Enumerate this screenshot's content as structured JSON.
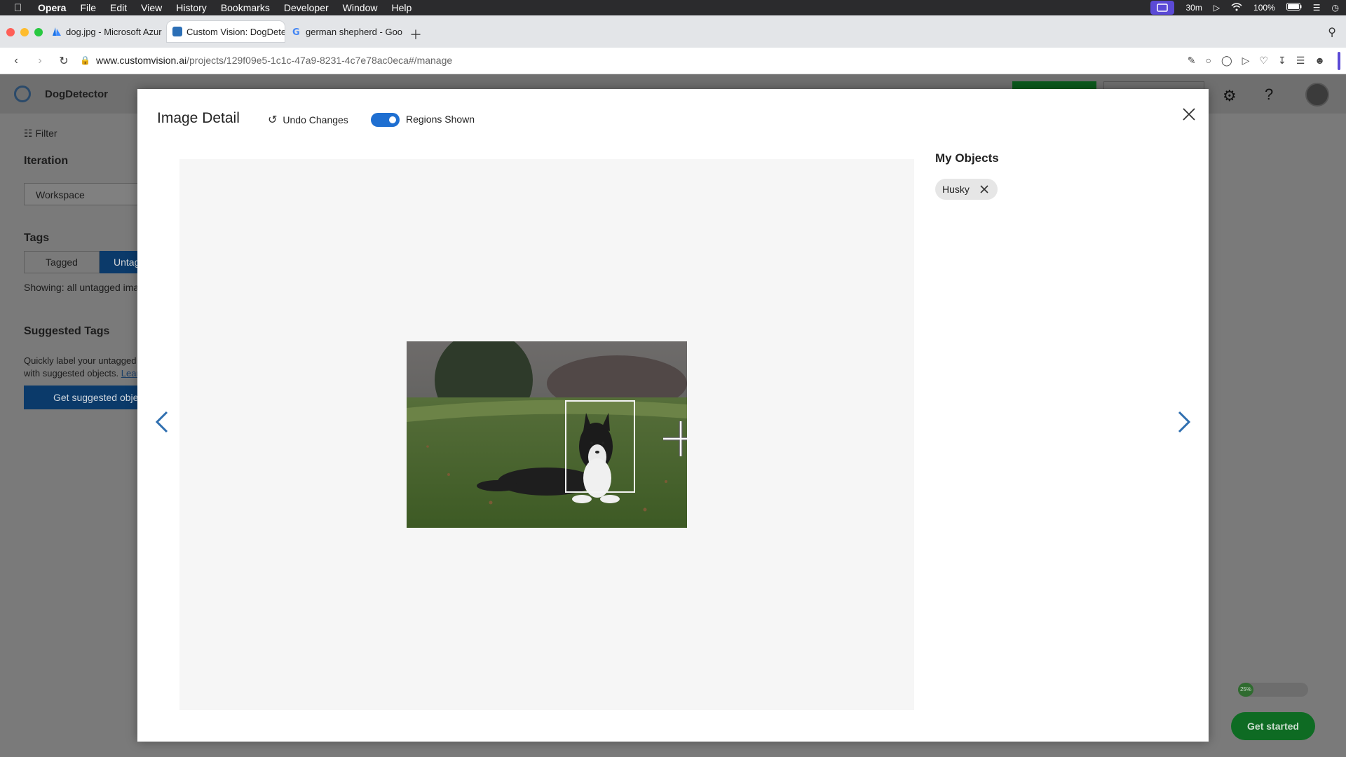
{
  "menubar": {
    "app": "Opera",
    "items": [
      "File",
      "Edit",
      "View",
      "History",
      "Bookmarks",
      "Developer",
      "Window",
      "Help"
    ],
    "timer": "30m",
    "battery": "100%"
  },
  "tabs": [
    {
      "label": "dog.jpg - Microsoft Azur",
      "favicon_color": "#1a73e8"
    },
    {
      "label": "Custom Vision: DogDete",
      "favicon_color": "#2c6fb6"
    },
    {
      "label": "german shepherd - Goo",
      "favicon_color": "#ea4335"
    }
  ],
  "address": {
    "domain": "www.customvision.ai",
    "path": "/projects/129f09e5-1c1c-47a9-8231-4c7e78ac0eca#/manage"
  },
  "background": {
    "project_name": "DogDetector",
    "filter_label": "Filter",
    "iteration_heading": "Iteration",
    "workspace_label": "Workspace",
    "tags_heading": "Tags",
    "tagged_label": "Tagged",
    "untagged_label": "Untag",
    "showing_text": "Showing: all untagged ima",
    "suggested_heading": "Suggested Tags",
    "quick_text": "Quickly label your untagged with suggested objects.",
    "quick_link": "Lear",
    "get_suggested_label": "Get suggested objec",
    "progress_label": "25%",
    "get_started_label": "Get started"
  },
  "modal": {
    "title": "Image Detail",
    "undo_label": "Undo Changes",
    "regions_label": "Regions Shown",
    "regions_on": true,
    "my_objects_heading": "My Objects",
    "objects": [
      {
        "label": "Husky"
      }
    ]
  },
  "colors": {
    "accent": "#1f6fd1",
    "primary_dark": "#0b3a6a",
    "green": "#0e6b23"
  }
}
